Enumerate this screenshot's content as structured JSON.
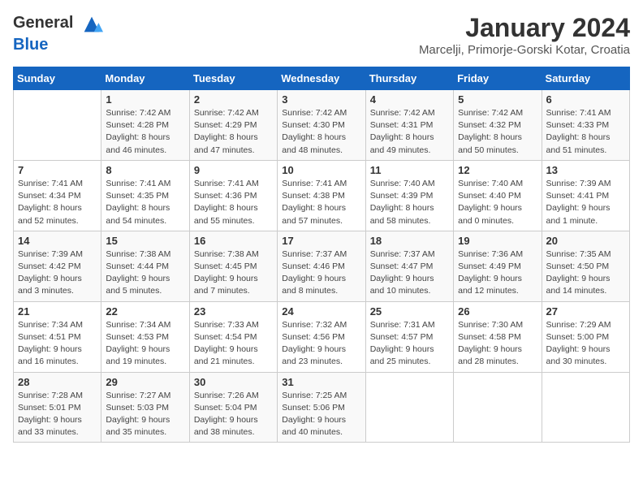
{
  "header": {
    "logo_general": "General",
    "logo_blue": "Blue",
    "month_year": "January 2024",
    "location": "Marcelji, Primorje-Gorski Kotar, Croatia"
  },
  "days_of_week": [
    "Sunday",
    "Monday",
    "Tuesday",
    "Wednesday",
    "Thursday",
    "Friday",
    "Saturday"
  ],
  "weeks": [
    [
      {
        "day": "",
        "sunrise": "",
        "sunset": "",
        "daylight": ""
      },
      {
        "day": "1",
        "sunrise": "Sunrise: 7:42 AM",
        "sunset": "Sunset: 4:28 PM",
        "daylight": "Daylight: 8 hours and 46 minutes."
      },
      {
        "day": "2",
        "sunrise": "Sunrise: 7:42 AM",
        "sunset": "Sunset: 4:29 PM",
        "daylight": "Daylight: 8 hours and 47 minutes."
      },
      {
        "day": "3",
        "sunrise": "Sunrise: 7:42 AM",
        "sunset": "Sunset: 4:30 PM",
        "daylight": "Daylight: 8 hours and 48 minutes."
      },
      {
        "day": "4",
        "sunrise": "Sunrise: 7:42 AM",
        "sunset": "Sunset: 4:31 PM",
        "daylight": "Daylight: 8 hours and 49 minutes."
      },
      {
        "day": "5",
        "sunrise": "Sunrise: 7:42 AM",
        "sunset": "Sunset: 4:32 PM",
        "daylight": "Daylight: 8 hours and 50 minutes."
      },
      {
        "day": "6",
        "sunrise": "Sunrise: 7:41 AM",
        "sunset": "Sunset: 4:33 PM",
        "daylight": "Daylight: 8 hours and 51 minutes."
      }
    ],
    [
      {
        "day": "7",
        "sunrise": "Sunrise: 7:41 AM",
        "sunset": "Sunset: 4:34 PM",
        "daylight": "Daylight: 8 hours and 52 minutes."
      },
      {
        "day": "8",
        "sunrise": "Sunrise: 7:41 AM",
        "sunset": "Sunset: 4:35 PM",
        "daylight": "Daylight: 8 hours and 54 minutes."
      },
      {
        "day": "9",
        "sunrise": "Sunrise: 7:41 AM",
        "sunset": "Sunset: 4:36 PM",
        "daylight": "Daylight: 8 hours and 55 minutes."
      },
      {
        "day": "10",
        "sunrise": "Sunrise: 7:41 AM",
        "sunset": "Sunset: 4:38 PM",
        "daylight": "Daylight: 8 hours and 57 minutes."
      },
      {
        "day": "11",
        "sunrise": "Sunrise: 7:40 AM",
        "sunset": "Sunset: 4:39 PM",
        "daylight": "Daylight: 8 hours and 58 minutes."
      },
      {
        "day": "12",
        "sunrise": "Sunrise: 7:40 AM",
        "sunset": "Sunset: 4:40 PM",
        "daylight": "Daylight: 9 hours and 0 minutes."
      },
      {
        "day": "13",
        "sunrise": "Sunrise: 7:39 AM",
        "sunset": "Sunset: 4:41 PM",
        "daylight": "Daylight: 9 hours and 1 minute."
      }
    ],
    [
      {
        "day": "14",
        "sunrise": "Sunrise: 7:39 AM",
        "sunset": "Sunset: 4:42 PM",
        "daylight": "Daylight: 9 hours and 3 minutes."
      },
      {
        "day": "15",
        "sunrise": "Sunrise: 7:38 AM",
        "sunset": "Sunset: 4:44 PM",
        "daylight": "Daylight: 9 hours and 5 minutes."
      },
      {
        "day": "16",
        "sunrise": "Sunrise: 7:38 AM",
        "sunset": "Sunset: 4:45 PM",
        "daylight": "Daylight: 9 hours and 7 minutes."
      },
      {
        "day": "17",
        "sunrise": "Sunrise: 7:37 AM",
        "sunset": "Sunset: 4:46 PM",
        "daylight": "Daylight: 9 hours and 8 minutes."
      },
      {
        "day": "18",
        "sunrise": "Sunrise: 7:37 AM",
        "sunset": "Sunset: 4:47 PM",
        "daylight": "Daylight: 9 hours and 10 minutes."
      },
      {
        "day": "19",
        "sunrise": "Sunrise: 7:36 AM",
        "sunset": "Sunset: 4:49 PM",
        "daylight": "Daylight: 9 hours and 12 minutes."
      },
      {
        "day": "20",
        "sunrise": "Sunrise: 7:35 AM",
        "sunset": "Sunset: 4:50 PM",
        "daylight": "Daylight: 9 hours and 14 minutes."
      }
    ],
    [
      {
        "day": "21",
        "sunrise": "Sunrise: 7:34 AM",
        "sunset": "Sunset: 4:51 PM",
        "daylight": "Daylight: 9 hours and 16 minutes."
      },
      {
        "day": "22",
        "sunrise": "Sunrise: 7:34 AM",
        "sunset": "Sunset: 4:53 PM",
        "daylight": "Daylight: 9 hours and 19 minutes."
      },
      {
        "day": "23",
        "sunrise": "Sunrise: 7:33 AM",
        "sunset": "Sunset: 4:54 PM",
        "daylight": "Daylight: 9 hours and 21 minutes."
      },
      {
        "day": "24",
        "sunrise": "Sunrise: 7:32 AM",
        "sunset": "Sunset: 4:56 PM",
        "daylight": "Daylight: 9 hours and 23 minutes."
      },
      {
        "day": "25",
        "sunrise": "Sunrise: 7:31 AM",
        "sunset": "Sunset: 4:57 PM",
        "daylight": "Daylight: 9 hours and 25 minutes."
      },
      {
        "day": "26",
        "sunrise": "Sunrise: 7:30 AM",
        "sunset": "Sunset: 4:58 PM",
        "daylight": "Daylight: 9 hours and 28 minutes."
      },
      {
        "day": "27",
        "sunrise": "Sunrise: 7:29 AM",
        "sunset": "Sunset: 5:00 PM",
        "daylight": "Daylight: 9 hours and 30 minutes."
      }
    ],
    [
      {
        "day": "28",
        "sunrise": "Sunrise: 7:28 AM",
        "sunset": "Sunset: 5:01 PM",
        "daylight": "Daylight: 9 hours and 33 minutes."
      },
      {
        "day": "29",
        "sunrise": "Sunrise: 7:27 AM",
        "sunset": "Sunset: 5:03 PM",
        "daylight": "Daylight: 9 hours and 35 minutes."
      },
      {
        "day": "30",
        "sunrise": "Sunrise: 7:26 AM",
        "sunset": "Sunset: 5:04 PM",
        "daylight": "Daylight: 9 hours and 38 minutes."
      },
      {
        "day": "31",
        "sunrise": "Sunrise: 7:25 AM",
        "sunset": "Sunset: 5:06 PM",
        "daylight": "Daylight: 9 hours and 40 minutes."
      },
      {
        "day": "",
        "sunrise": "",
        "sunset": "",
        "daylight": ""
      },
      {
        "day": "",
        "sunrise": "",
        "sunset": "",
        "daylight": ""
      },
      {
        "day": "",
        "sunrise": "",
        "sunset": "",
        "daylight": ""
      }
    ]
  ]
}
